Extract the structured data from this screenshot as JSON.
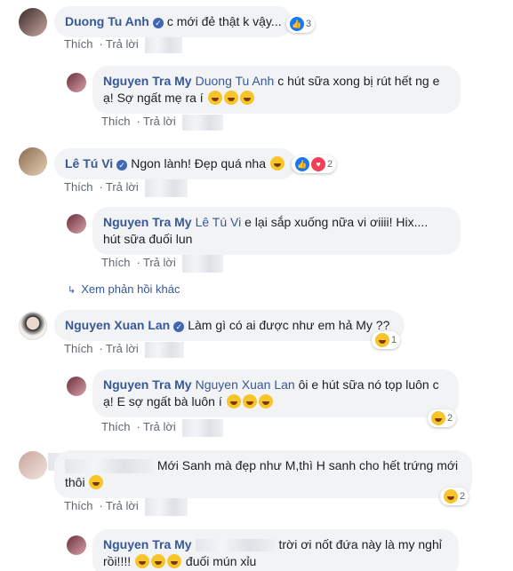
{
  "actions": {
    "like": "Thích",
    "reply": "Trả lời"
  },
  "comments": [
    {
      "name": "Duong Tu Anh",
      "text": "c mới đẻ thật k vậy...",
      "reactions": "3"
    },
    {
      "name": "Nguyen Tra My",
      "mention": "Duong Tu Anh",
      "text1": "c hút sữa xong bị rút hết ng e",
      "text2": "ạ! Sợ ngất mẹ ra í"
    },
    {
      "name": "Lê Tú Vi",
      "text": "Ngon lành! Đẹp quá nha",
      "reactions": "2"
    },
    {
      "name": "Nguyen Tra My",
      "mention": "Lê Tú Vi",
      "text1": "e lại sắp xuống nữa vi ơiiii! Hix....",
      "text2": "hút sữa đuối lun"
    },
    {
      "name": "Nguyen Xuan Lan",
      "text": "Làm gì có ai được như em hả My ??",
      "reactions": "1"
    },
    {
      "name": "Nguyen Tra My",
      "mention": "Nguyen Xuan Lan",
      "text1": "ôi e hút sữa nó tọp luôn c",
      "text2": "ạ! E sợ ngất bà luôn í",
      "reactions": "2"
    },
    {
      "text1": "Mới Sanh mà đẹp như M,thì H sanh cho hết trứng mới",
      "text2": "thôi",
      "reactions": "2"
    },
    {
      "name": "Nguyen Tra My",
      "text1": "trời ơi nốt đứa này là my nghỉ",
      "text2": "rồi!!!!",
      "text3": "đuối mún xỉu"
    }
  ],
  "more_replies": "Xem phản hồi khác",
  "colors": {
    "link": "#385898",
    "bubble": "#f2f3f5",
    "meta": "#606770"
  }
}
